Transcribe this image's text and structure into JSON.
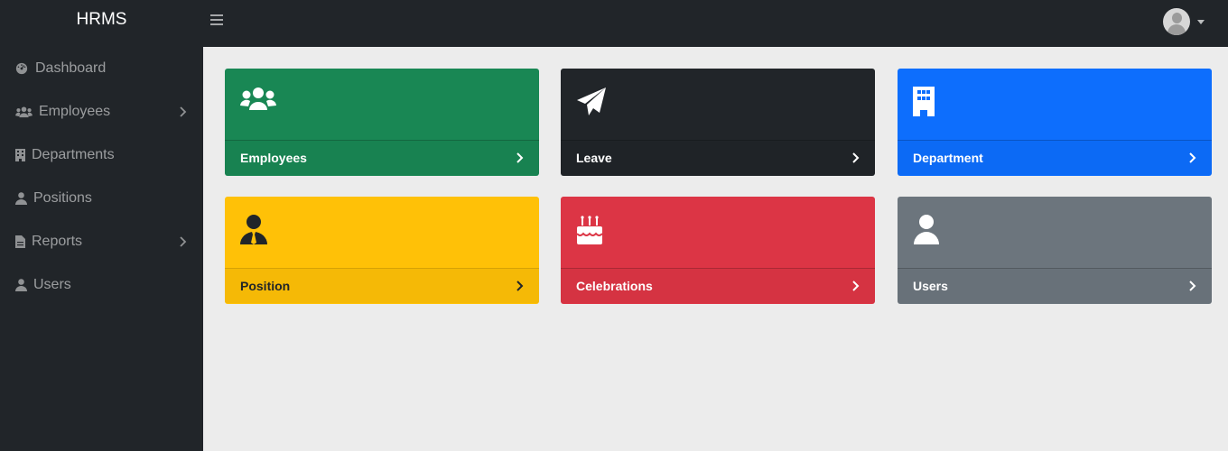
{
  "app": {
    "brand": "HRMS"
  },
  "sidebar": {
    "items": [
      {
        "label": "Dashboard",
        "icon": "dashboard-icon",
        "has_submenu": false
      },
      {
        "label": "Employees",
        "icon": "users-icon",
        "has_submenu": true
      },
      {
        "label": "Departments",
        "icon": "building-icon",
        "has_submenu": false
      },
      {
        "label": "Positions",
        "icon": "user-tie-icon",
        "has_submenu": false
      },
      {
        "label": "Reports",
        "icon": "file-icon",
        "has_submenu": true
      },
      {
        "label": "Users",
        "icon": "user-icon",
        "has_submenu": false
      }
    ]
  },
  "topbar": {
    "toggle_icon": "hamburger-icon",
    "avatar_icon": "avatar-icon",
    "menu_icon": "caret-down-icon"
  },
  "cards": [
    {
      "label": "Employees",
      "icon": "users-icon",
      "color": "#198754"
    },
    {
      "label": "Leave",
      "icon": "paper-plane-icon",
      "color": "#212529"
    },
    {
      "label": "Department",
      "icon": "building-icon",
      "color": "#0d6efd"
    },
    {
      "label": "Position",
      "icon": "user-tie-icon",
      "color": "#ffc107"
    },
    {
      "label": "Celebrations",
      "icon": "birthday-cake-icon",
      "color": "#dc3545"
    },
    {
      "label": "Users",
      "icon": "user-icon",
      "color": "#6c757d"
    }
  ]
}
